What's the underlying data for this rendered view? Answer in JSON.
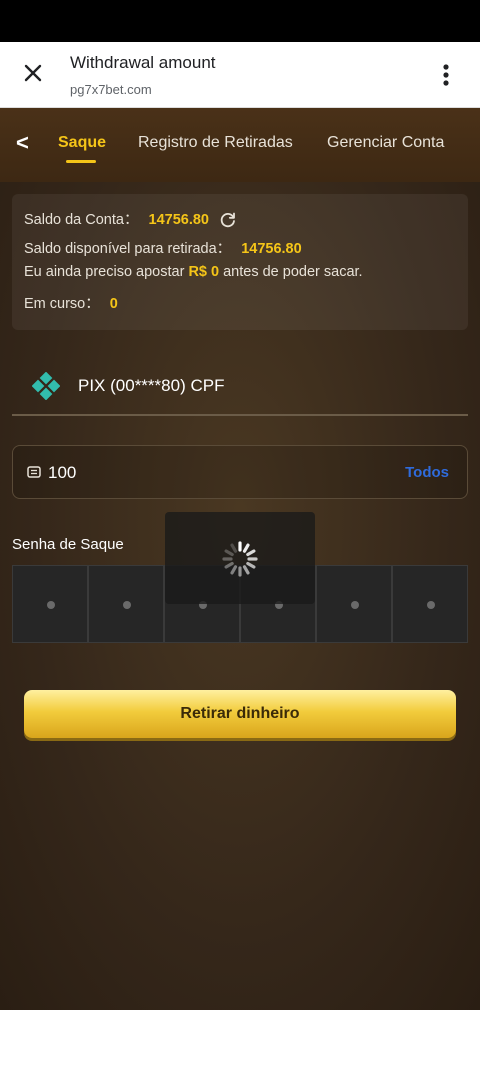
{
  "browser": {
    "title": "Withdrawal amount",
    "url": "pg7x7bet.com",
    "close_icon": "close-icon",
    "menu_icon": "more-vert-icon"
  },
  "nav": {
    "back_label": "<",
    "tabs": [
      {
        "label": "Saque",
        "active": true
      },
      {
        "label": "Registro de Retiradas",
        "active": false
      },
      {
        "label": "Gerenciar Conta",
        "active": false
      }
    ]
  },
  "account": {
    "saldo_label": "Saldo da Conta：",
    "saldo_value": "14756.80",
    "disponivel_label": "Saldo disponível para retirada：",
    "disponivel_value": "14756.80",
    "aposta_prefix": "Eu ainda preciso apostar ",
    "aposta_value": "R$ 0",
    "aposta_suffix": " antes de poder sacar.",
    "em_curso_label": "Em curso：",
    "em_curso_value": "0"
  },
  "method": {
    "label": "PIX (00****80) CPF",
    "icon": "pix-icon"
  },
  "amount": {
    "value": "100",
    "all_label": "Todos"
  },
  "password": {
    "label": "Senha de Saque",
    "digits": 6
  },
  "actions": {
    "withdraw_label": "Retirar dinheiro"
  },
  "colors": {
    "accent": "#f5c518",
    "link": "#2f6bdc"
  }
}
